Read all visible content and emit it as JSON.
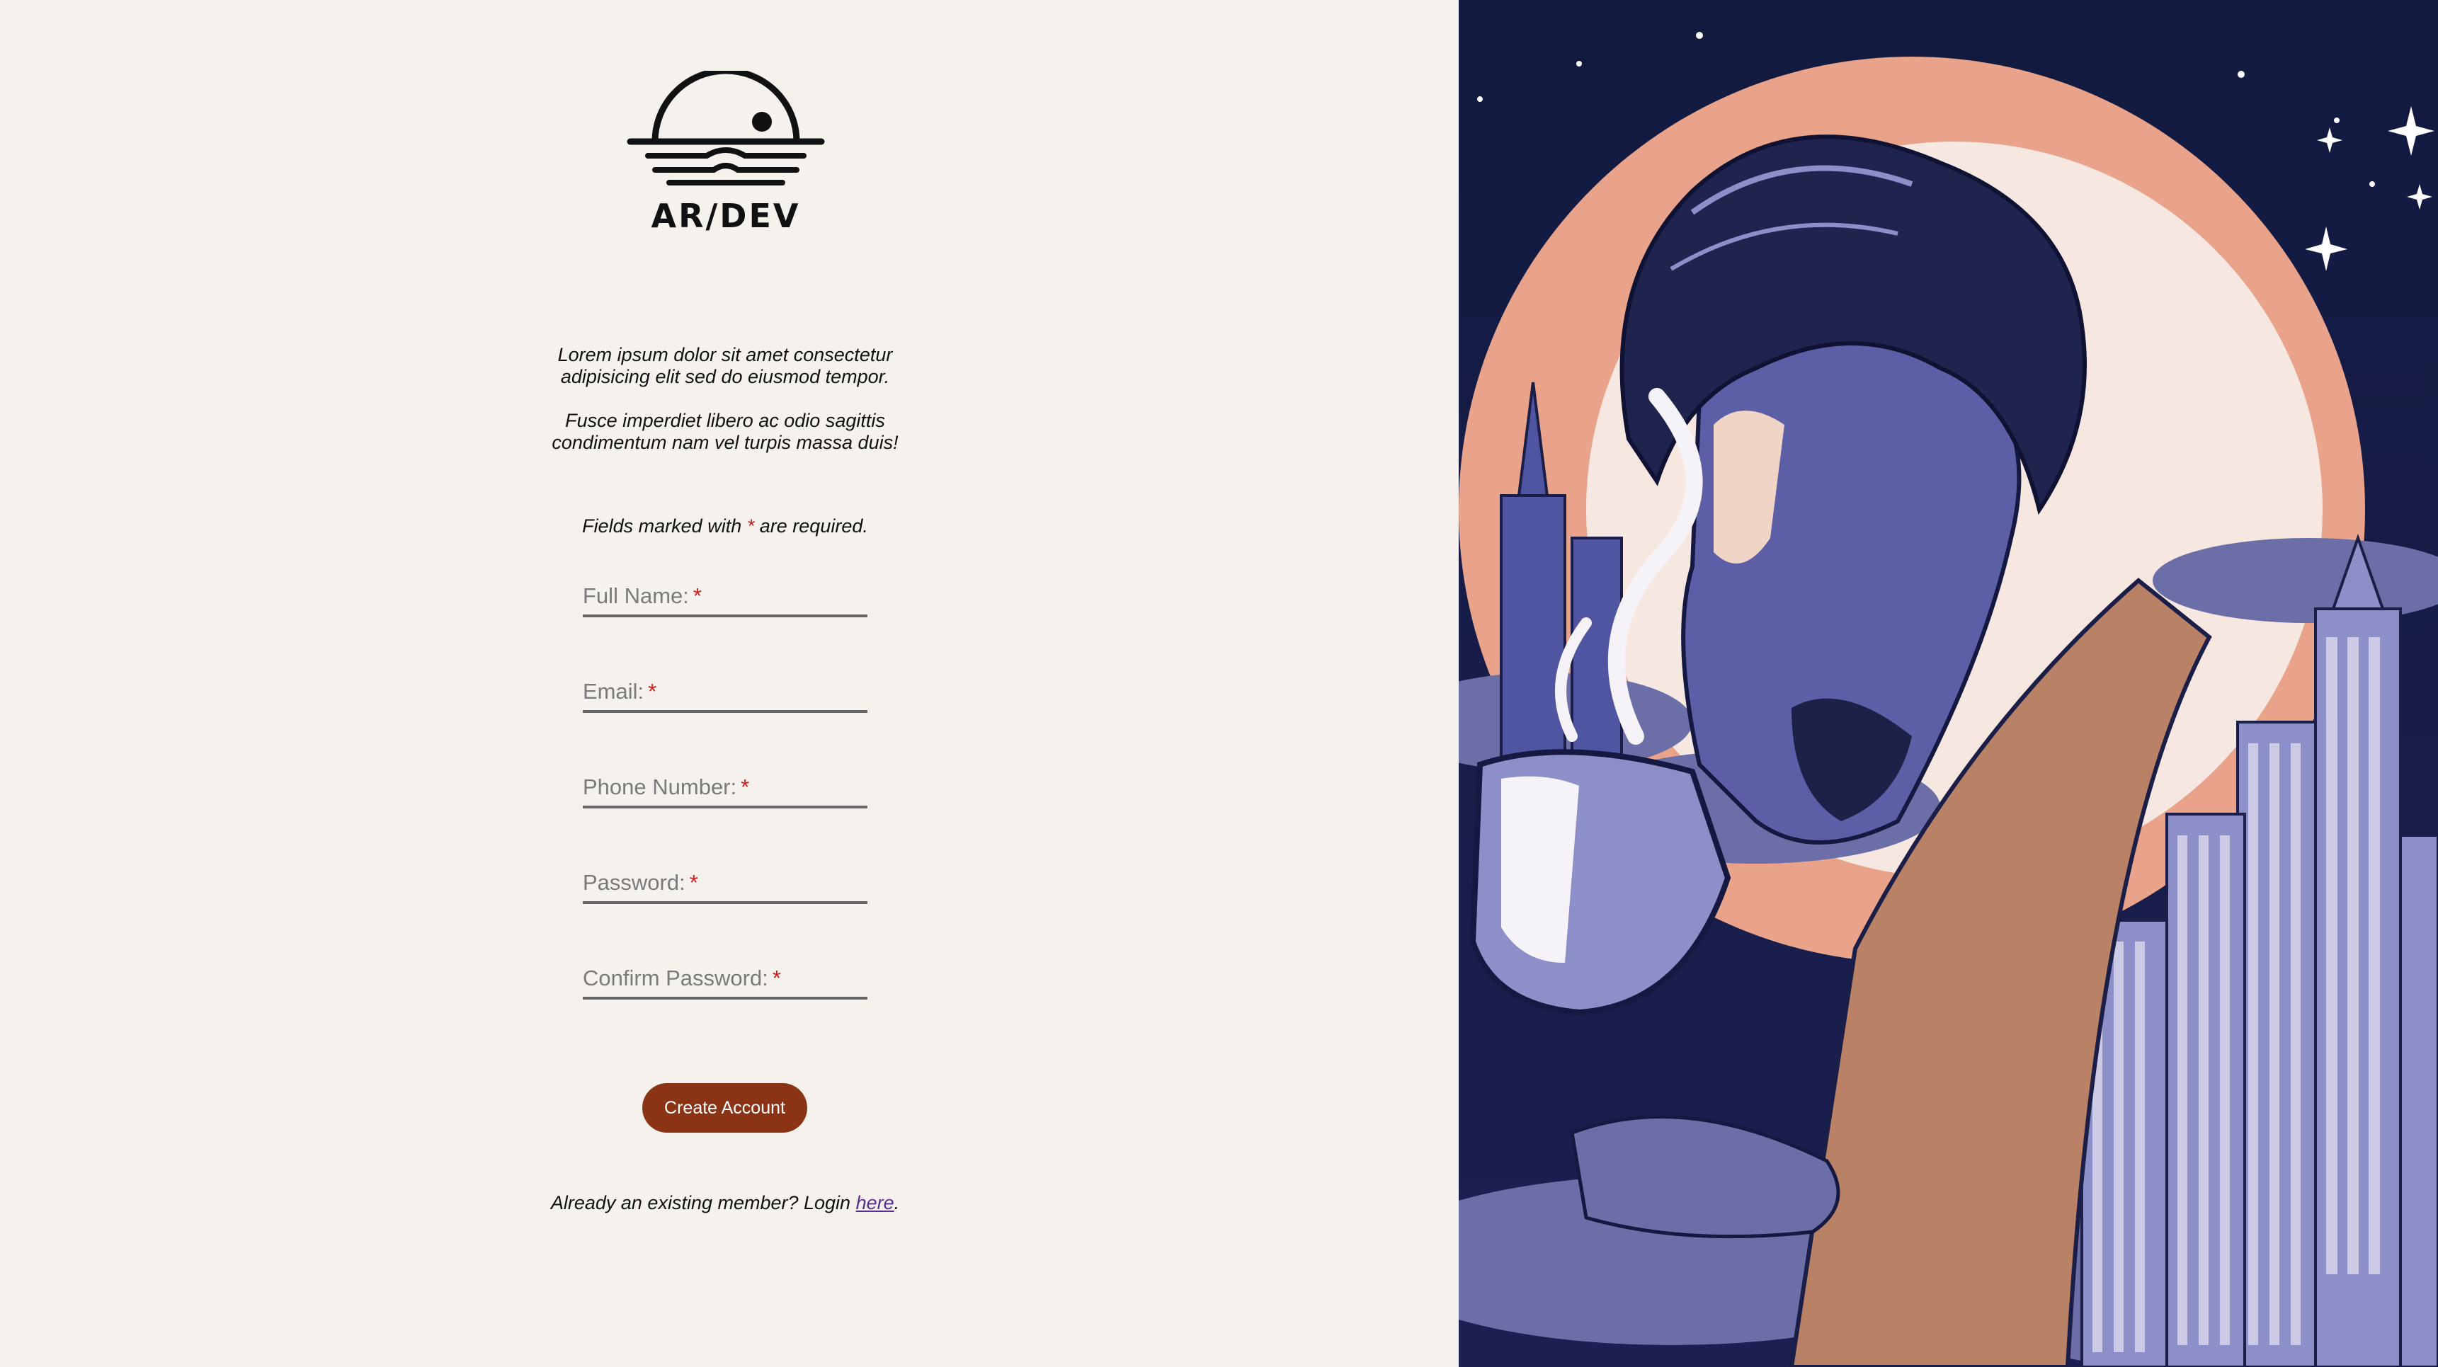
{
  "brand": {
    "name": "AR/DEV",
    "logo_icon": "sunset-over-water-logo"
  },
  "intro": {
    "line1": "Lorem ipsum dolor sit amet consectetur adipisicing elit sed do eiusmod tempor.",
    "line2": "Fusce imperdiet libero ac odio sagittis condimentum nam vel turpis massa duis!"
  },
  "form": {
    "required_note_prefix": "Fields marked with",
    "required_marker": "*",
    "required_note_suffix": "are required.",
    "fields": [
      {
        "label": "Full Name:",
        "required": true
      },
      {
        "label": "Email:",
        "required": true
      },
      {
        "label": "Phone Number:",
        "required": true
      },
      {
        "label": "Password:",
        "required": true
      },
      {
        "label": "Confirm Password:",
        "required": true
      }
    ],
    "submit_label": "Create Account"
  },
  "login": {
    "prefix": "Already an existing member? Login",
    "link_text": "here",
    "suffix": "."
  },
  "illustration": {
    "subject": "man-drinking-coffee-city-illustration"
  },
  "colors": {
    "background": "#f5f2ed",
    "button": "#8b3415",
    "required": "#d01c1c",
    "link": "#5b2d8e"
  }
}
